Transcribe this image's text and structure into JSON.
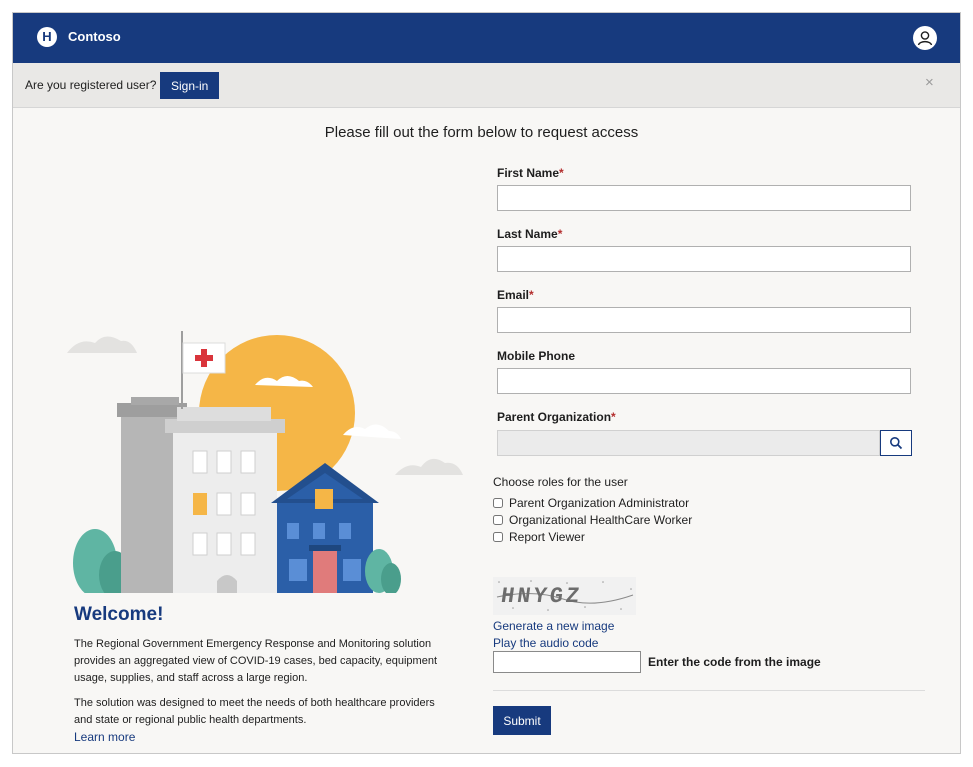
{
  "header": {
    "brand": "Contoso",
    "logo_letter": "H"
  },
  "notice": {
    "text": "Are you registered user?",
    "signin_label": "Sign-in",
    "close_glyph": "×"
  },
  "form": {
    "title": "Please fill out the form below to request access",
    "fields": [
      {
        "label": "First Name",
        "required": true,
        "value": ""
      },
      {
        "label": "Last Name",
        "required": true,
        "value": ""
      },
      {
        "label": "Email",
        "required": true,
        "value": ""
      },
      {
        "label": "Mobile Phone",
        "required": false,
        "value": ""
      },
      {
        "label": "Parent Organization",
        "required": true,
        "value": ""
      }
    ],
    "required_mark": "*",
    "roles_title": "Choose roles for the user",
    "roles": [
      {
        "label": "Parent Organization Administrator",
        "checked": false
      },
      {
        "label": "Organizational HealthCare Worker",
        "checked": false
      },
      {
        "label": "Report Viewer",
        "checked": false
      }
    ],
    "captcha": {
      "image_text": "HNYGZ",
      "generate_link": "Generate a new image",
      "audio_link": "Play the audio code",
      "code_label": "Enter the code from the image",
      "code_value": ""
    },
    "submit_label": "Submit"
  },
  "welcome": {
    "title": "Welcome!",
    "para1": "The Regional Government Emergency Response and Monitoring solution provides an aggregated view of COVID-19 cases, bed capacity, equipment usage, supplies, and staff across a large region.",
    "para2": "The solution was designed to meet the needs of both healthcare providers and state or regional public health departments.",
    "learn_more": "Learn more"
  },
  "colors": {
    "brand_blue": "#173a7e",
    "required_red": "#b32d2d",
    "sun": "#f5b647",
    "flag_cross": "#d9343b"
  }
}
